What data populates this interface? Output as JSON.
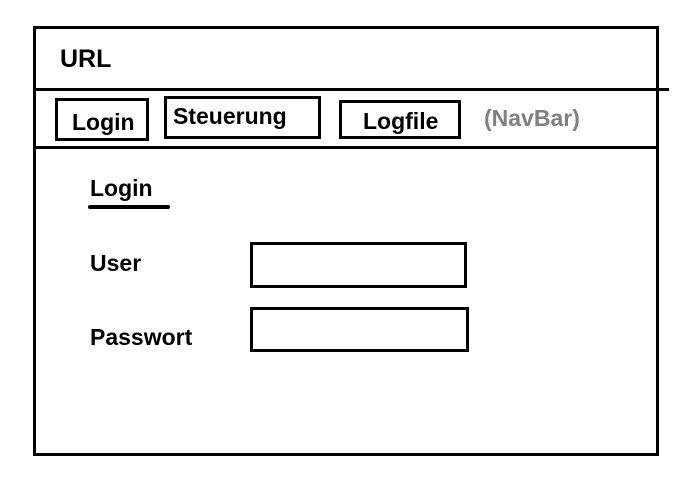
{
  "url_bar": {
    "text": "URL"
  },
  "navbar": {
    "items": [
      {
        "label": "Login"
      },
      {
        "label": "Steuerung"
      },
      {
        "label": "Logfile"
      }
    ],
    "caption": "(NavBar)"
  },
  "login_form": {
    "title": "Login",
    "user": {
      "label": "User",
      "value": ""
    },
    "password": {
      "label": "Passwort",
      "value": ""
    }
  },
  "colors": {
    "border": "#000000",
    "caption": "#808080",
    "background": "#ffffff"
  }
}
